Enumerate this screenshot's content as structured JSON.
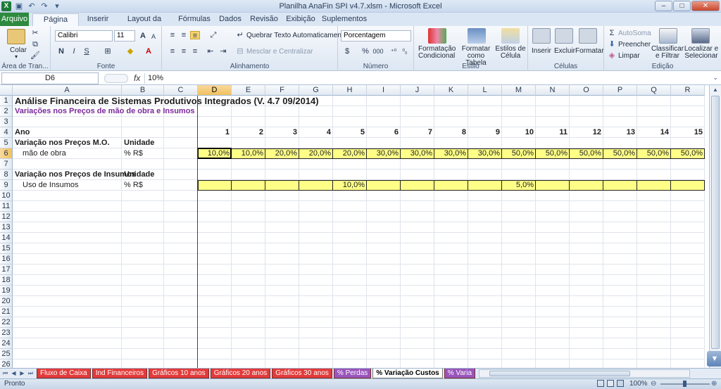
{
  "window": {
    "title": "Planilha AnaFin SPI v4.7.xlsm  -  Microsoft Excel"
  },
  "tabs": {
    "file": "Arquivo",
    "items": [
      "Página Inicial",
      "Inserir",
      "Layout da Página",
      "Fórmulas",
      "Dados",
      "Revisão",
      "Exibição",
      "Suplementos"
    ],
    "active": "Página Inicial"
  },
  "ribbon": {
    "clipboard": {
      "label": "Área de Tran...",
      "paste": "Colar"
    },
    "font": {
      "label": "Fonte",
      "name": "Calibri",
      "size": "11",
      "bold": "N",
      "italic": "I",
      "underline": "S"
    },
    "alignment": {
      "label": "Alinhamento",
      "wrap": "Quebrar Texto Automaticamente",
      "merge": "Mesclar e Centralizar"
    },
    "number": {
      "label": "Número",
      "format": "Porcentagem",
      "percent": "%",
      "thousands": "000"
    },
    "styles": {
      "label": "Estilo",
      "cond": "Formatação Condicional",
      "table": "Formatar como Tabela",
      "cell": "Estilos de Célula"
    },
    "cells": {
      "label": "Células",
      "insert": "Inserir",
      "delete": "Excluir",
      "format": "Formatar"
    },
    "editing": {
      "label": "Edição",
      "autosum": "AutoSoma",
      "fill": "Preencher",
      "clear": "Limpar",
      "sort": "Classificar e Filtrar",
      "find": "Localizar e Selecionar"
    }
  },
  "formula_bar": {
    "name_box": "D6",
    "fx": "fx",
    "value": "10%"
  },
  "columns": [
    "A",
    "B",
    "C",
    "D",
    "E",
    "F",
    "G",
    "H",
    "I",
    "J",
    "K",
    "L",
    "M",
    "N",
    "O",
    "P",
    "Q",
    "R"
  ],
  "selected_col": "D",
  "rows": [
    "1",
    "2",
    "3",
    "4",
    "5",
    "6",
    "7",
    "8",
    "9",
    "10",
    "11",
    "12",
    "13",
    "14",
    "15",
    "16",
    "17",
    "18",
    "19",
    "20",
    "21",
    "22",
    "23",
    "24",
    "25",
    "26"
  ],
  "selected_row": "6",
  "cells": {
    "a1": "Análise Financeira de Sistemas Produtivos Integrados (V. 4.7 09/2014)",
    "a2": "Variações nos Preços de mão de obra e Insumos",
    "a4": "Ano",
    "a5": "Variação nos Preços M.O.",
    "b5": "Unidade",
    "a6": "mão de obra",
    "b6": "% R$",
    "a8": "Variação nos Preços de Insumos",
    "b8": "Unidade",
    "a9": "Uso de Insumos",
    "b9": "% R$",
    "years": [
      "1",
      "2",
      "3",
      "4",
      "5",
      "6",
      "7",
      "8",
      "9",
      "10",
      "11",
      "12",
      "13",
      "14",
      "15"
    ],
    "row6": [
      "10,0%",
      "10,0%",
      "20,0%",
      "20,0%",
      "20,0%",
      "30,0%",
      "30,0%",
      "30,0%",
      "30,0%",
      "50,0%",
      "50,0%",
      "50,0%",
      "50,0%",
      "50,0%",
      "50,0%"
    ],
    "row9": [
      "",
      "",
      "",
      "",
      "10,0%",
      "",
      "",
      "",
      "",
      "5,0%",
      "",
      "",
      "",
      "",
      ""
    ]
  },
  "sheet_tabs": [
    {
      "name": "Fluxo de Caixa",
      "color": "red"
    },
    {
      "name": "Ind Financeiros",
      "color": "red"
    },
    {
      "name": "Gráficos 10 anos",
      "color": "red"
    },
    {
      "name": "Gráficos 20 anos",
      "color": "red"
    },
    {
      "name": "Gráficos 30 anos",
      "color": "red"
    },
    {
      "name": "% Perdas",
      "color": "purple"
    },
    {
      "name": "% Variação Custos",
      "color": "active"
    },
    {
      "name": "% Varia",
      "color": "purple"
    }
  ],
  "status": {
    "ready": "Pronto",
    "zoom": "100%"
  }
}
